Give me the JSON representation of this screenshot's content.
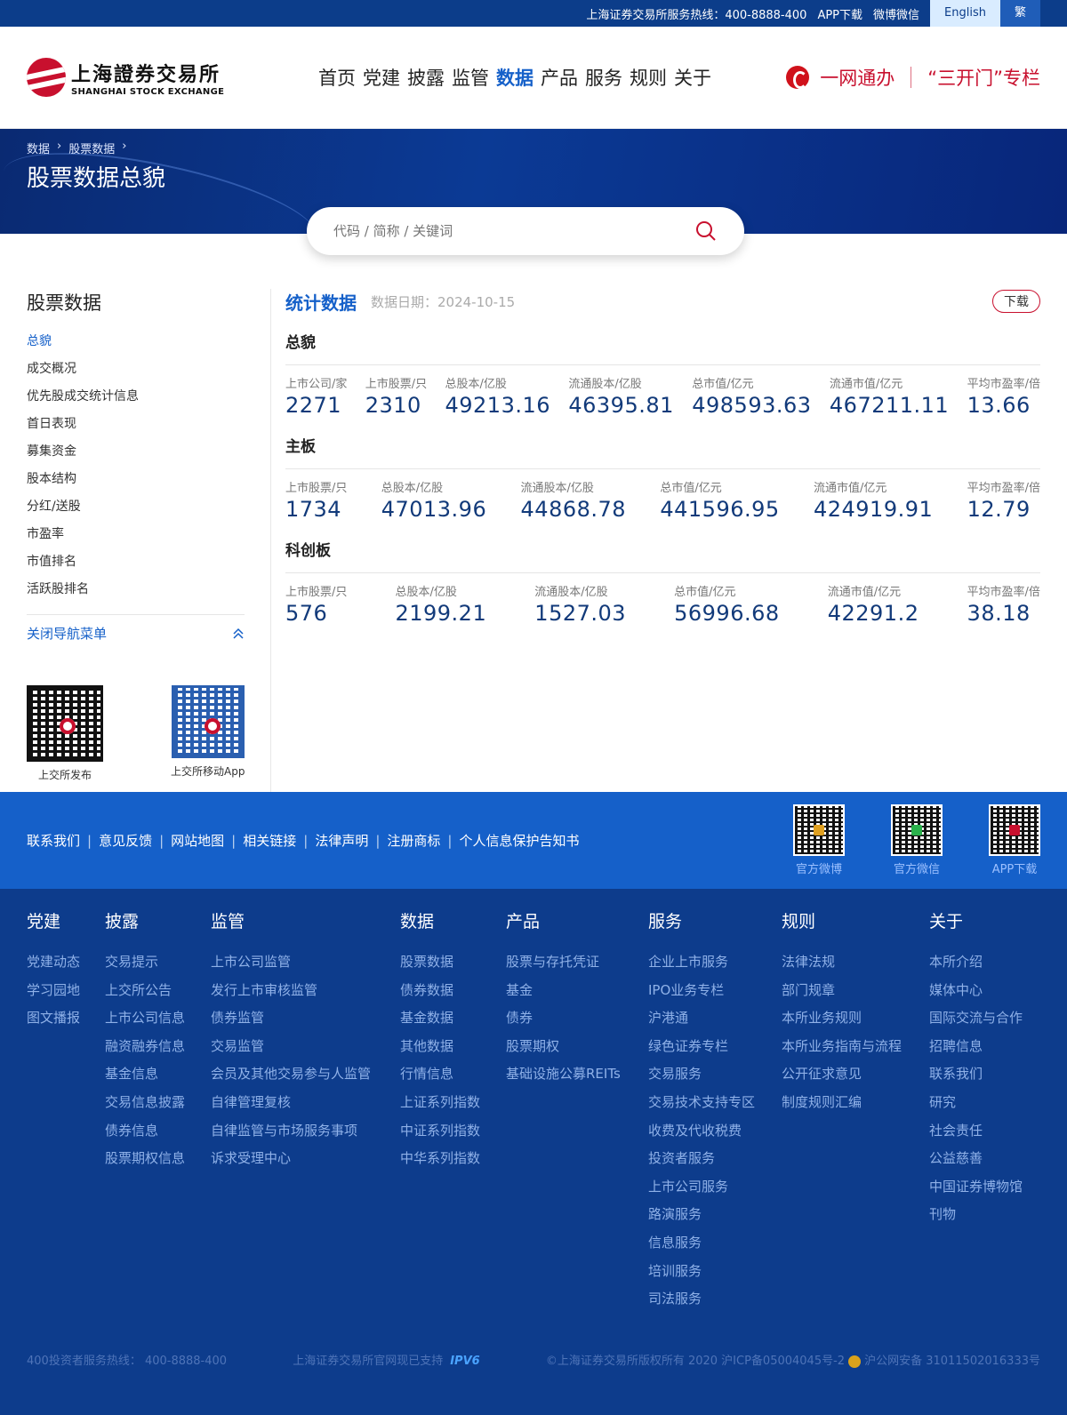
{
  "topbar": {
    "hotline": "上海证券交易所服务热线：400-8888-400",
    "app": "APP下载",
    "weibo": "微博微信",
    "english": "English",
    "traditional": "繁"
  },
  "header": {
    "logo_cn": "上海證券交易所",
    "logo_en": "SHANGHAI STOCK EXCHANGE",
    "nav": [
      "首页",
      "党建",
      "披露",
      "监管",
      "数据",
      "产品",
      "服务",
      "规则",
      "关于"
    ],
    "active_nav": "数据",
    "ywtb": "一网通办",
    "skm": "“三开门”专栏"
  },
  "banner": {
    "crumbs": [
      "数据",
      "股票数据"
    ],
    "title": "股票数据总貌",
    "search_placeholder": "代码 / 简称 / 关键词"
  },
  "sidebar": {
    "title": "股票数据",
    "items": [
      "总貌",
      "成交概况",
      "优先股成交统计信息",
      "首日表现",
      "募集资金",
      "股本结构",
      "分红/送股",
      "市盈率",
      "市值排名",
      "活跃股排名"
    ],
    "active": "总貌",
    "close_label": "关闭导航菜单",
    "qr1_caption": "上交所发布",
    "qr2_caption": "上交所移动App"
  },
  "content": {
    "title": "统计数据",
    "date": "数据日期：2024-10-15",
    "download": "下载",
    "sections": [
      {
        "title": "总貌",
        "stats": [
          {
            "label": "上市公司/家",
            "value": "2271"
          },
          {
            "label": "上市股票/只",
            "value": "2310"
          },
          {
            "label": "总股本/亿股",
            "value": "49213.16"
          },
          {
            "label": "流通股本/亿股",
            "value": "46395.81"
          },
          {
            "label": "总市值/亿元",
            "value": "498593.63"
          },
          {
            "label": "流通市值/亿元",
            "value": "467211.11"
          },
          {
            "label": "平均市盈率/倍",
            "value": "13.66"
          }
        ]
      },
      {
        "title": "主板",
        "stats": [
          {
            "label": "上市股票/只",
            "value": "1734"
          },
          {
            "label": "总股本/亿股",
            "value": "47013.96"
          },
          {
            "label": "流通股本/亿股",
            "value": "44868.78"
          },
          {
            "label": "总市值/亿元",
            "value": "441596.95"
          },
          {
            "label": "流通市值/亿元",
            "value": "424919.91"
          },
          {
            "label": "平均市盈率/倍",
            "value": "12.79"
          }
        ]
      },
      {
        "title": "科创板",
        "stats": [
          {
            "label": "上市股票/只",
            "value": "576"
          },
          {
            "label": "总股本/亿股",
            "value": "2199.21"
          },
          {
            "label": "流通股本/亿股",
            "value": "1527.03"
          },
          {
            "label": "总市值/亿元",
            "value": "56996.68"
          },
          {
            "label": "流通市值/亿元",
            "value": "42291.2"
          },
          {
            "label": "平均市盈率/倍",
            "value": "38.18"
          }
        ]
      }
    ]
  },
  "footer_links": [
    "联系我们",
    "意见反馈",
    "网站地图",
    "相关链接",
    "法律声明",
    "注册商标",
    "个人信息保护告知书"
  ],
  "footer_qrs": [
    "官方微博",
    "官方微信",
    "APP下载"
  ],
  "footer_cols": [
    {
      "head": "党建",
      "items": [
        "党建动态",
        "学习园地",
        "图文播报"
      ]
    },
    {
      "head": "披露",
      "items": [
        "交易提示",
        "上交所公告",
        "上市公司信息",
        "融资融券信息",
        "基金信息",
        "交易信息披露",
        "债券信息",
        "股票期权信息"
      ]
    },
    {
      "head": "监管",
      "items": [
        "上市公司监管",
        "发行上市审核监管",
        "债券监管",
        "交易监管",
        "会员及其他交易参与人监管",
        "自律管理复核",
        "自律监管与市场服务事项",
        "诉求受理中心"
      ]
    },
    {
      "head": "数据",
      "items": [
        "股票数据",
        "债券数据",
        "基金数据",
        "其他数据",
        "行情信息",
        "上证系列指数",
        "中证系列指数",
        "中华系列指数"
      ]
    },
    {
      "head": "产品",
      "items": [
        "股票与存托凭证",
        "基金",
        "债券",
        "股票期权",
        "基础设施公募REITs"
      ]
    },
    {
      "head": "服务",
      "items": [
        "企业上市服务",
        "IPO业务专栏",
        "沪港通",
        "绿色证券专栏",
        "交易服务",
        "交易技术支持专区",
        "收费及代收税费",
        "投资者服务",
        "上市公司服务",
        "路演服务",
        "信息服务",
        "培训服务",
        "司法服务"
      ]
    },
    {
      "head": "规则",
      "items": [
        "法律法规",
        "部门规章",
        "本所业务规则",
        "本所业务指南与流程",
        "公开征求意见",
        "制度规则汇编"
      ]
    },
    {
      "head": "关于",
      "items": [
        "本所介绍",
        "媒体中心",
        "国际交流与合作",
        "招聘信息",
        "联系我们",
        "研究",
        "社会责任",
        "公益慈善",
        "中国证券博物馆",
        "刊物"
      ]
    }
  ],
  "copyright": {
    "hotline": "400投资者服务热线： 400-8888-400",
    "ipv6_text": "上海证券交易所官网现已支持",
    "ipv6": "IPV6",
    "rights": "©上海证券交易所版权所有 2020 沪ICP备05004045号-2",
    "police": "沪公网安备 31011502016333号"
  }
}
